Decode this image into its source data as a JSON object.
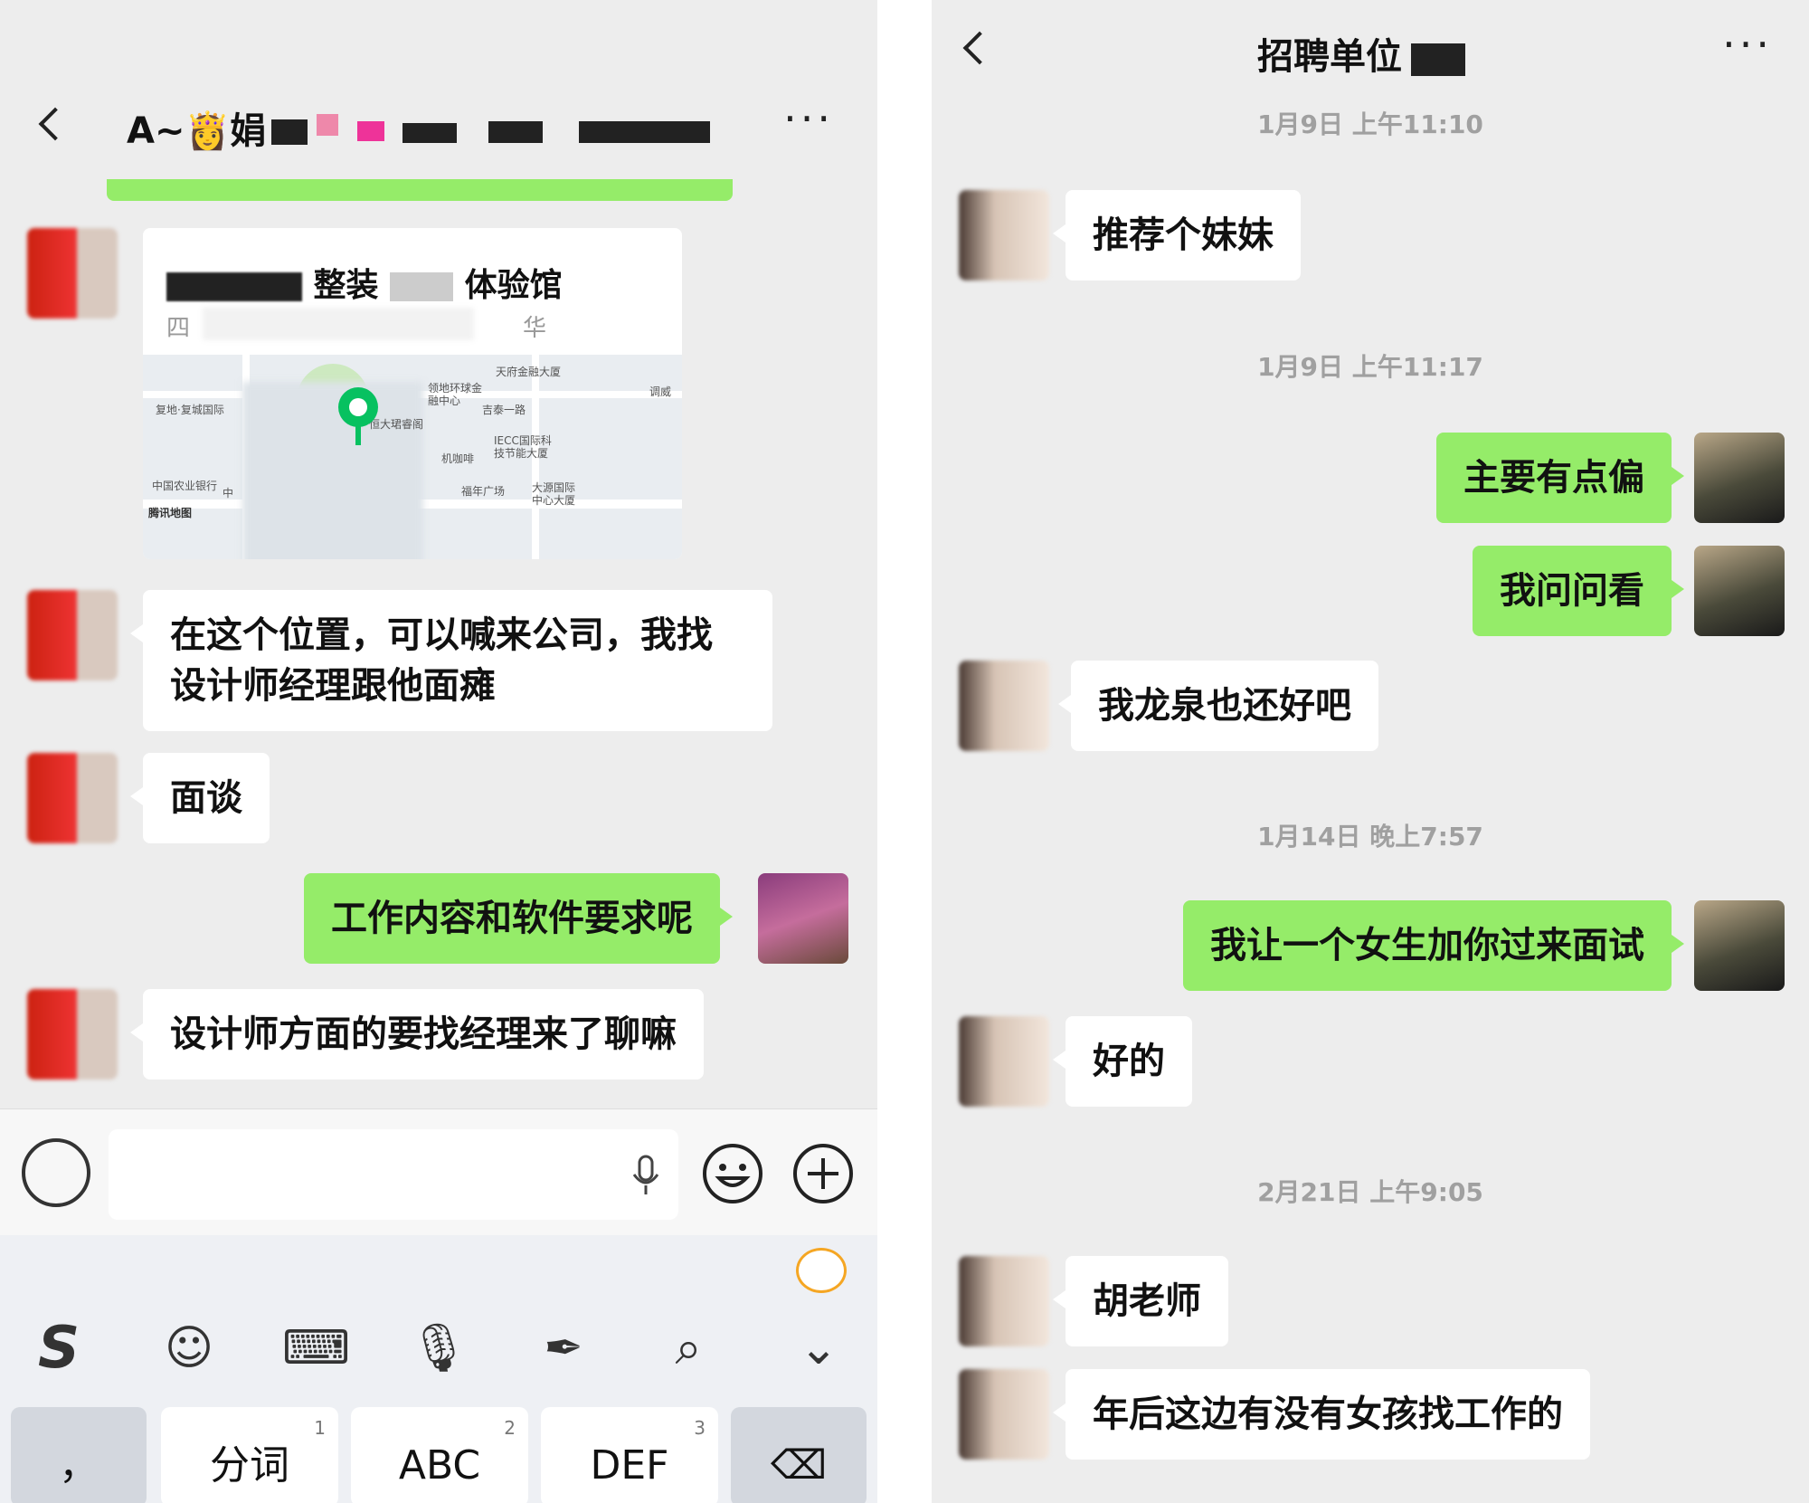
{
  "left": {
    "contact_name": "A~👸娟",
    "location_card": {
      "title_fragment": "整装",
      "title_fragment2": "体验馆",
      "address_start": "四",
      "address_mid": "华",
      "map_labels": [
        "天府金融大厦",
        "领地环球金融中心",
        "调威",
        "复地·复城国际",
        "吉泰一路",
        "恒大珺睿阁",
        "IECC国际科技节能大厦",
        "机咖啡",
        "中国农业银行",
        "中",
        "福年广场",
        "大源国际中心大厦"
      ],
      "map_source": "腾讯地图"
    },
    "messages": [
      {
        "side": "in",
        "text": "在这个位置，可以喊来公司，我找设计师经理跟他面瘫"
      },
      {
        "side": "in",
        "text": "面谈"
      },
      {
        "side": "out",
        "text": "工作内容和软件要求呢"
      },
      {
        "side": "in",
        "text": "设计师方面的要找经理来了聊嘛"
      }
    ],
    "toolbar_icons": [
      "sogou-logo-icon",
      "emoji-icon",
      "keyboard-icon",
      "mic-icon",
      "pen-icon",
      "search-icon",
      "chevron-down-icon"
    ],
    "keys": [
      {
        "label": "，",
        "num": ""
      },
      {
        "label": "分词",
        "num": "1"
      },
      {
        "label": "ABC",
        "num": "2"
      },
      {
        "label": "DEF",
        "num": "3"
      },
      {
        "label": "⌫",
        "num": ""
      }
    ]
  },
  "right": {
    "title": "招聘单位",
    "timestamps": [
      "1月9日 上午11:10",
      "1月9日 上午11:17",
      "1月14日 晚上7:57",
      "2月21日 上午9:05"
    ],
    "messages": [
      {
        "side": "in",
        "text": "推荐个妹妹"
      },
      {
        "side": "out",
        "text": "主要有点偏"
      },
      {
        "side": "out",
        "text": "我问问看"
      },
      {
        "side": "in",
        "text": "我龙泉也还好吧"
      },
      {
        "side": "out",
        "text": "我让一个女生加你过来面试"
      },
      {
        "side": "in",
        "text": "好的"
      },
      {
        "side": "in",
        "text": "胡老师"
      },
      {
        "side": "in",
        "text": "年后这边有没有女孩找工作的"
      }
    ]
  },
  "colors": {
    "accent": "#95ec69",
    "background": "#ededed",
    "pin": "#07c160"
  }
}
